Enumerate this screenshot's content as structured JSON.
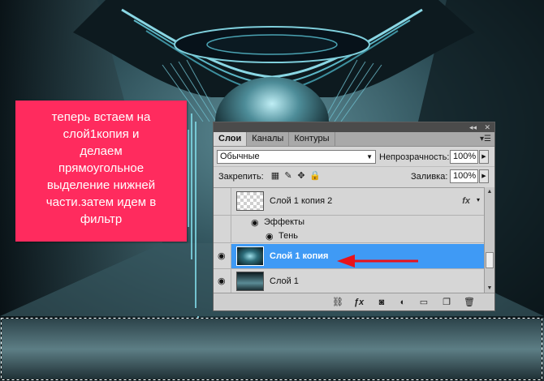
{
  "note": {
    "text": "теперь встаем на\nслой1копия и\nделаем\nпрямоугольное\nвыделение нижней\nчасти.затем идем в\nфильтр"
  },
  "panel": {
    "tabs": [
      {
        "label": "Слои",
        "active": true
      },
      {
        "label": "Каналы",
        "active": false
      },
      {
        "label": "Контуры",
        "active": false
      }
    ],
    "blend_mode": "Обычные",
    "opacity_label": "Непрозрачность:",
    "opacity_value": "100%",
    "lock_label": "Закрепить:",
    "fill_label": "Заливка:",
    "fill_value": "100%",
    "layers": [
      {
        "name": "Слой 1 копия 2",
        "visible": false,
        "selected": false,
        "has_fx": true,
        "fx_label": "fx"
      },
      {
        "name": "Слой 1 копия",
        "visible": true,
        "selected": true,
        "has_fx": false
      },
      {
        "name": "Слой 1",
        "visible": true,
        "selected": false,
        "has_fx": false
      }
    ],
    "effects_label": "Эффекты",
    "shadow_label": "Тень"
  },
  "icons": {
    "eye": "eye-icon",
    "link": "link-icon",
    "fx": "fx-icon",
    "mask": "mask-icon",
    "adjustment": "adjustment-icon",
    "folder": "folder-icon",
    "new_layer": "new-layer-icon",
    "trash": "trash-icon"
  },
  "colors": {
    "note_bg": "#ff2b5e",
    "selection": "#3f9af5",
    "arrow": "#e8121a"
  }
}
